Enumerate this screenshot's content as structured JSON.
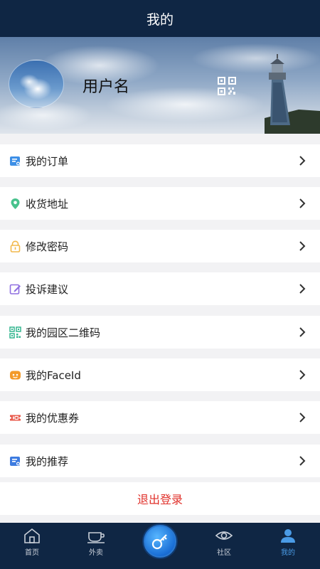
{
  "header": {
    "title": "我的"
  },
  "profile": {
    "username": "用户名"
  },
  "menu": [
    {
      "label": "我的订单",
      "icon": "order-icon",
      "color": "#3d8fe6"
    },
    {
      "label": "收货地址",
      "icon": "location-pin-icon",
      "color": "#48c28d"
    },
    {
      "label": "修改密码",
      "icon": "lock-icon",
      "color": "#f2b84b"
    },
    {
      "label": "投诉建议",
      "icon": "edit-icon",
      "color": "#8f6fe0"
    },
    {
      "label": "我的园区二维码",
      "icon": "qr-code-icon",
      "color": "#33b58f"
    },
    {
      "label": "我的FaceId",
      "icon": "face-id-icon",
      "color": "#f39a2a"
    },
    {
      "label": "我的优惠券",
      "icon": "coupon-icon",
      "color": "#e8584a"
    },
    {
      "label": "我的推荐",
      "icon": "recommend-icon",
      "color": "#3d7be0"
    }
  ],
  "logout": {
    "label": "退出登录",
    "color": "#e0302a"
  },
  "tabbar": {
    "tabs": [
      {
        "label": "首页",
        "icon": "home-icon"
      },
      {
        "label": "外卖",
        "icon": "coffee-cup-icon"
      },
      {
        "label": "",
        "icon": "key-icon"
      },
      {
        "label": "社区",
        "icon": "eye-icon"
      },
      {
        "label": "我的",
        "icon": "user-icon"
      }
    ],
    "active_index": 4,
    "active_color": "#4a9be6"
  }
}
